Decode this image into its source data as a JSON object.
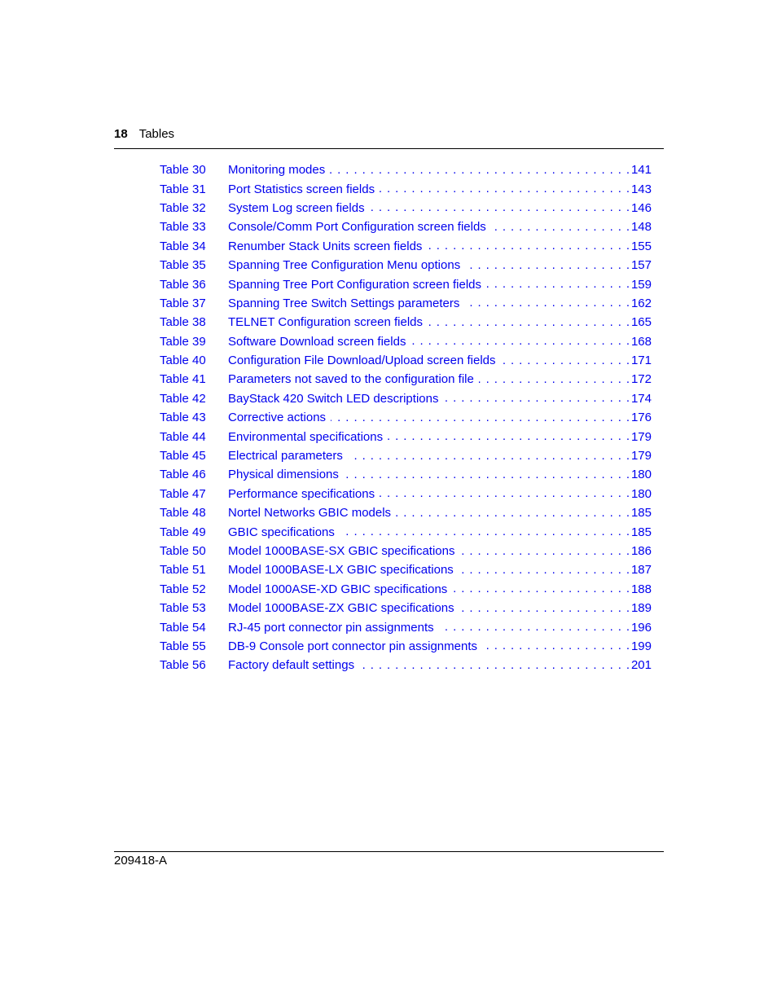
{
  "header": {
    "page_number": "18",
    "section": "Tables"
  },
  "toc": {
    "link_color": "#0000ee",
    "entries": [
      {
        "label": "Table 30",
        "title": "Monitoring modes",
        "page": "141"
      },
      {
        "label": "Table 31",
        "title": "Port Statistics screen fields",
        "page": "143"
      },
      {
        "label": "Table 32",
        "title": "System Log screen fields",
        "page": "146"
      },
      {
        "label": "Table 33",
        "title": "Console/Comm Port Configuration screen fields",
        "page": "148"
      },
      {
        "label": "Table 34",
        "title": "Renumber Stack Units screen fields",
        "page": "155"
      },
      {
        "label": "Table 35",
        "title": "Spanning Tree Configuration Menu options",
        "page": "157"
      },
      {
        "label": "Table 36",
        "title": "Spanning Tree Port Configuration screen fields",
        "page": "159"
      },
      {
        "label": "Table 37",
        "title": "Spanning Tree Switch Settings parameters",
        "page": "162"
      },
      {
        "label": "Table 38",
        "title": "TELNET Configuration screen fields",
        "page": "165"
      },
      {
        "label": "Table 39",
        "title": "Software Download screen fields",
        "page": "168"
      },
      {
        "label": "Table 40",
        "title": "Configuration File Download/Upload screen fields",
        "page": "171"
      },
      {
        "label": "Table 41",
        "title": "Parameters not saved to the configuration file",
        "page": "172"
      },
      {
        "label": "Table 42",
        "title": "BayStack 420 Switch LED descriptions",
        "page": "174"
      },
      {
        "label": "Table 43",
        "title": "Corrective actions",
        "page": "176"
      },
      {
        "label": "Table 44",
        "title": "Environmental specifications",
        "page": "179"
      },
      {
        "label": "Table 45",
        "title": "Electrical parameters",
        "page": "179"
      },
      {
        "label": "Table 46",
        "title": "Physical dimensions",
        "page": "180"
      },
      {
        "label": "Table 47",
        "title": "Performance specifications",
        "page": "180"
      },
      {
        "label": "Table 48",
        "title": "Nortel Networks GBIC models",
        "page": "185"
      },
      {
        "label": "Table 49",
        "title": "GBIC specifications",
        "page": "185"
      },
      {
        "label": "Table 50",
        "title": "Model 1000BASE-SX GBIC specifications",
        "page": "186"
      },
      {
        "label": "Table 51",
        "title": "Model 1000BASE-LX GBIC specifications",
        "page": "187"
      },
      {
        "label": "Table 52",
        "title": "Model 1000ASE-XD GBIC specifications",
        "page": "188"
      },
      {
        "label": "Table 53",
        "title": "Model 1000BASE-ZX GBIC specifications",
        "page": "189"
      },
      {
        "label": "Table 54",
        "title": "RJ-45 port connector pin assignments",
        "page": "196"
      },
      {
        "label": "Table 55",
        "title": "DB-9 Console port connector pin assignments",
        "page": "199"
      },
      {
        "label": "Table 56",
        "title": "Factory default settings",
        "page": "201"
      }
    ]
  },
  "footer": {
    "doc_number": "209418-A"
  }
}
